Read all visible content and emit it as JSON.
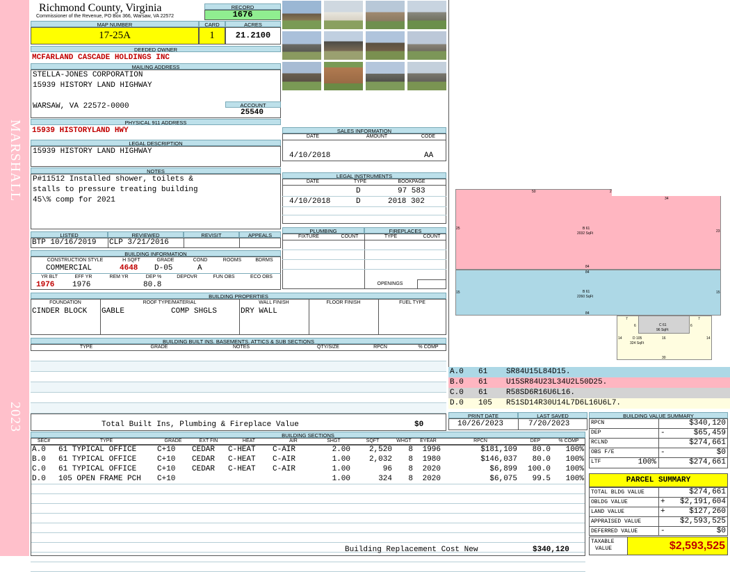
{
  "side": {
    "district": "MARSHALL",
    "year": "2023"
  },
  "header": {
    "county": "Richmond County, Virginia",
    "commissioner": "Commissioner of the Revenue, PO Box 366, Warsaw, VA 22572",
    "record_label": "RECORD",
    "record": "1676",
    "map_label": "MAP NUMBER",
    "map_number": "17-25A",
    "card_label": "CARD",
    "card": "1",
    "acres_label": "ACRES",
    "acres": "21.2100"
  },
  "owner": {
    "deeded_label": "DEEDED OWNER",
    "deeded": "MCFARLAND CASCADE HOLDINGS INC",
    "mailing_label": "MAILING ADDRESS",
    "mail1": "STELLA-JONES CORPORATION",
    "mail2": "15939 HISTORY LAND HIGHWAY",
    "mail3": "WARSAW, VA 22572-0000",
    "account_label": "ACCOUNT",
    "account": "25540",
    "physical_label": "PHYSICAL 911 ADDRESS",
    "physical": "15939 HISTORYLAND HWY",
    "legal_label": "LEGAL DESCRIPTION",
    "legal": "15939 HISTORY LAND HIGHWAY",
    "notes_label": "NOTES",
    "notes1": "P#11512 Installed shower, toilets &",
    "notes2": "stalls to pressure treating building",
    "notes3": "45\\% comp for 2021"
  },
  "sales": {
    "title": "SALES INFORMATION",
    "h_date": "DATE",
    "h_amount": "AMOUNT",
    "h_code": "CODE",
    "date": "4/10/2018",
    "code": "AA"
  },
  "legal_instr": {
    "title": "LEGAL INSTRUMENTS",
    "h_date": "DATE",
    "h_type": "TYPE",
    "h_book": "BOOKPAGE",
    "r1_type": "D",
    "r1_book": "97 583",
    "r2_date": "4/10/2018",
    "r2_type": "D",
    "r2_book": "2018 302"
  },
  "plumbing": {
    "title": "PLUMBING",
    "h_fixture": "FIXTURE",
    "h_count": "COUNT"
  },
  "fireplaces": {
    "title": "FIREPLACES",
    "h_type": "TYPE",
    "h_count": "COUNT",
    "openings": "OPENINGS"
  },
  "listing": {
    "listed_label": "LISTED",
    "reviewed_label": "REVIEWED",
    "revisit_label": "REVISIT",
    "appeals_label": "APPEALS",
    "listed": "BTP 10/16/2019",
    "reviewed": "CLP  3/21/2016"
  },
  "building_info": {
    "title": "BUILDING INFORMATION",
    "h_style": "CONSTRUCTION STYLE",
    "h_hsqft": "H SQFT",
    "h_grade": "GRADE",
    "h_cond": "COND",
    "h_rooms": "ROOMS",
    "h_bdrms": "BDRMS",
    "style": "COMMERCIAL",
    "hsqft": "4648",
    "grade": "D-05",
    "cond": "A",
    "h_yrblt": "YR BLT",
    "h_effyr": "EFF YR",
    "h_remyr": "REM YR",
    "h_dep": "DEP %",
    "h_depovr": "DEPOVR",
    "h_funobs": "FUN OBS",
    "h_ecoobs": "ECO OBS",
    "yrblt": "1976",
    "effyr": "1976",
    "dep": "80.8"
  },
  "properties": {
    "title": "BUILDING PROPERTIES",
    "h_foundation": "FOUNDATION",
    "h_roof": "ROOF TYPE/MATERIAL",
    "h_wall": "WALL FINISH",
    "h_floor": "FLOOR FINISH",
    "h_fuel": "FUEL TYPE",
    "foundation": "CINDER BLOCK",
    "roof_type": "GABLE",
    "roof_mat": "COMP SHGLS",
    "wall": "DRY WALL"
  },
  "builtins": {
    "title": "BUILDING BUILT INS, BASEMENTS, ATTICS & SUB SECTIONS",
    "h_type": "TYPE",
    "h_grade": "GRADE",
    "h_notes": "NOTES",
    "h_qty": "QTY/SIZE",
    "h_rpcn": "RPCN",
    "h_comp": "% COMP",
    "total_label": "Total Built Ins, Plumbing & Fireplace Value",
    "total": "$0"
  },
  "dates": {
    "print_label": "PRINT DATE",
    "saved_label": "LAST SAVED",
    "print": "10/26/2023",
    "saved": "7/20/2023"
  },
  "sections": {
    "title": "BUILDING SECTIONS",
    "headers": [
      "SEC#",
      "TYPE",
      "GRADE",
      "EXT FIN",
      "HEAT",
      "AIR",
      "SHGT",
      "SQFT",
      "WHGT",
      "EYEAR",
      "RPCN",
      "DEP",
      "% COMP"
    ],
    "rows": [
      [
        "A.0",
        "61 TYPICAL OFFICE",
        "C+10",
        "CEDAR",
        "C-HEAT",
        "C-AIR",
        "2.00",
        "2,520",
        "8",
        "1996",
        "$181,109",
        "80.0",
        "100%"
      ],
      [
        "B.0",
        "61 TYPICAL OFFICE",
        "C+10",
        "CEDAR",
        "C-HEAT",
        "C-AIR",
        "1.00",
        "2,032",
        "8",
        "1980",
        "$146,037",
        "80.0",
        "100%"
      ],
      [
        "C.0",
        "61 TYPICAL OFFICE",
        "C+10",
        "CEDAR",
        "C-HEAT",
        "C-AIR",
        "1.00",
        "96",
        "8",
        "2020",
        "$6,899",
        "100.0",
        "100%"
      ],
      [
        "D.0",
        "105 OPEN FRAME PCH",
        "C+10",
        "",
        "",
        "",
        "1.00",
        "324",
        "8",
        "2020",
        "$6,075",
        "99.5",
        "100%"
      ]
    ],
    "replacement_label": "Building Replacement Cost New",
    "replacement": "$340,120"
  },
  "sketch": {
    "a_label": "B 61",
    "a_area": "2032 SqFt",
    "b_label": "B 61",
    "b_area": "2260 SqFt",
    "c_label": "C 61",
    "c_area": "96 SqFt",
    "d_label": "D 105",
    "d_area": "324 SqFt",
    "dims": [
      "50",
      "2",
      "34",
      "25",
      "23",
      "84",
      "84",
      "15",
      "15",
      "84",
      "7",
      "7",
      "6",
      "6",
      "14",
      "14",
      "16",
      "30"
    ],
    "colors": {
      "pink": "#ffb6c1",
      "blue": "#add8e6",
      "gray": "#d3d3d3",
      "yellow": "#fffde0"
    }
  },
  "codes": [
    {
      "sec": "A.0",
      "type": "61",
      "code": "SR84U15L84D15."
    },
    {
      "sec": "B.0",
      "type": "61",
      "code": "U15SR84U23L34U2L50D25."
    },
    {
      "sec": "C.0",
      "type": "61",
      "code": "R58SD6R16U6L16."
    },
    {
      "sec": "D.0",
      "type": "105",
      "code": "R51SD14R30U14L7D6L16U6L7."
    }
  ],
  "bvs": {
    "title": "BUILDING VALUE SUMMARY",
    "rows": [
      {
        "label": "RPCN",
        "sign": "",
        "value": "$340,120"
      },
      {
        "label": "DEP",
        "sign": "-",
        "value": "$65,459"
      },
      {
        "label": "RCLND",
        "sign": "",
        "value": "$274,661"
      },
      {
        "label": "OBS F/E",
        "sign": "-",
        "value": "$0"
      }
    ],
    "ltf_label": "LTF",
    "ltf_pct": "100%",
    "ltf_value": "$274,661"
  },
  "parcel": {
    "title": "PARCEL SUMMARY",
    "rows": [
      {
        "label": "TOTAL BLDG VALUE",
        "sign": "",
        "value": "$274,661"
      },
      {
        "label": "OBLDG VALUE",
        "sign": "+",
        "value": "$2,191,604"
      },
      {
        "label": "LAND VALUE",
        "sign": "+",
        "value": "$127,260"
      },
      {
        "label": "APPRAISED VALUE",
        "sign": "",
        "value": "$2,593,525"
      },
      {
        "label": "DEFERRED VALUE",
        "sign": "-",
        "value": "$0"
      }
    ],
    "taxable_label1": "TAXABLE",
    "taxable_label2": "VALUE",
    "taxable": "$2,593,525"
  }
}
